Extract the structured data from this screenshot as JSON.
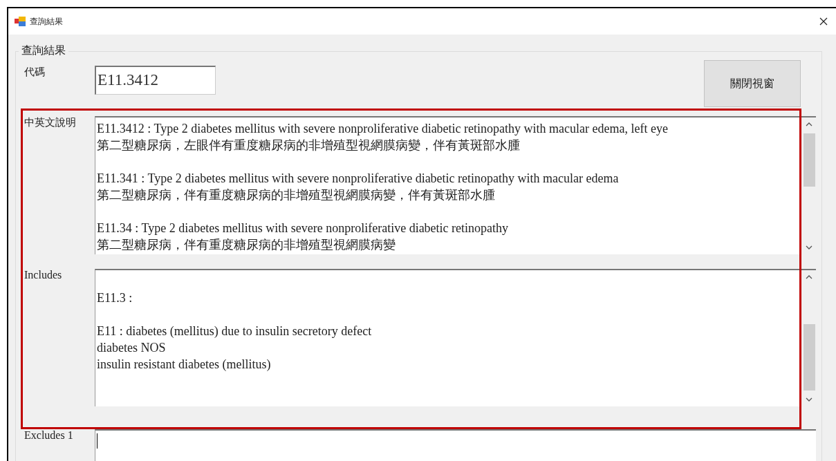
{
  "window": {
    "title": "查詢結果"
  },
  "group": {
    "title": "查詢結果"
  },
  "code": {
    "label": "代碼",
    "value": "E11.3412"
  },
  "close_button": "關閉視窗",
  "description": {
    "label": "中英文說明",
    "entries": [
      [
        "E11.3412 : Type 2 diabetes mellitus with severe nonproliferative diabetic retinopathy with macular edema, left eye",
        "第二型糖尿病，左眼伴有重度糖尿病的非增殖型視網膜病變，伴有黃斑部水腫"
      ],
      [
        "E11.341 : Type 2 diabetes mellitus with severe nonproliferative diabetic retinopathy with macular edema",
        "第二型糖尿病，伴有重度糖尿病的非增殖型視網膜病變，伴有黃斑部水腫"
      ],
      [
        "E11.34 : Type 2 diabetes mellitus with severe nonproliferative diabetic retinopathy",
        "第二型糖尿病，伴有重度糖尿病的非增殖型視網膜病變"
      ]
    ]
  },
  "includes": {
    "label": "Includes",
    "entries": [
      [
        "E11.3 :"
      ],
      [
        "E11 : diabetes (mellitus) due to insulin secretory defect",
        "diabetes NOS",
        "insulin resistant diabetes (mellitus)"
      ]
    ]
  },
  "excludes_1": {
    "label": "Excludes 1"
  }
}
